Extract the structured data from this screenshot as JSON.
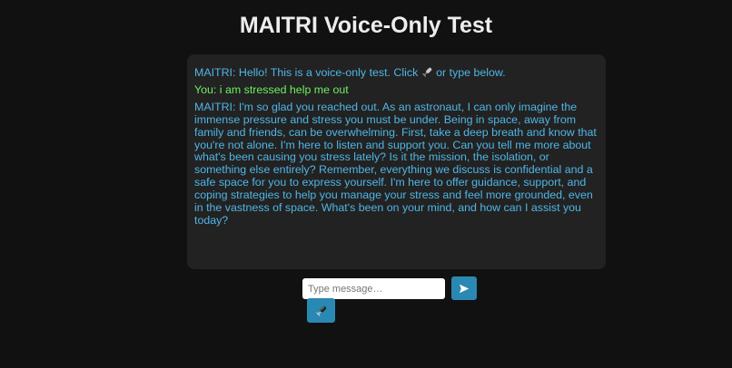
{
  "page": {
    "title": "MAITRI Voice-Only Test"
  },
  "chat": {
    "greeting_prefix": "MAITRI: Hello! This is a voice-only test. Click ",
    "greeting_suffix": " or type below.",
    "greeting_icon": "microphone-icon",
    "user_message": "You: i am stressed help me out",
    "bot_reply": "MAITRI: I'm so glad you reached out. As an astronaut, I can only imagine the immense pressure and stress you must be under. Being in space, away from family and friends, can be overwhelming. First, take a deep breath and know that you're not alone. I'm here to listen and support you. Can you tell me more about what's been causing you stress lately? Is it the mission, the isolation, or something else entirely? Remember, everything we discuss is confidential and a safe space for you to express yourself. I'm here to offer guidance, support, and coping strategies to help you manage your stress and feel more grounded, even in the vastness of space. What's been on your mind, and how can I assist you today?"
  },
  "composer": {
    "input_value": "",
    "input_placeholder": "Type message…",
    "send_icon": "send-arrow-icon",
    "mic_icon": "microphone-icon"
  },
  "colors": {
    "background": "#111111",
    "panel": "#222222",
    "bot_text": "#4fb6e6",
    "user_text": "#6df060",
    "button": "#2a89b3"
  }
}
